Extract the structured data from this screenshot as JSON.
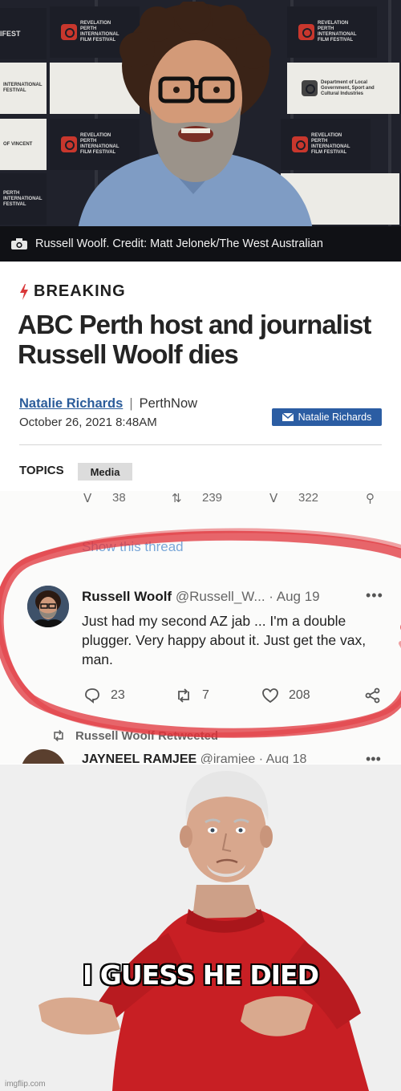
{
  "photo": {
    "caption": "Russell Woolf. Credit: Matt Jelonek/The West Australian",
    "backdrop_tiles": [
      {
        "text": "IFEST"
      },
      {
        "text": "REVELATION PERTH INTERNATIONAL FILM FESTIVAL"
      },
      {
        "text": "REVELATION PERTH INTERNATIONAL FILM FESTIVAL"
      },
      {
        "text": "INTERNATIONAL FESTIVAL"
      },
      {
        "text": "Department of Local Government, Sport and Cultural Industries"
      },
      {
        "text": "OF VINCENT"
      },
      {
        "text": "REVELATION PERTH INTERNATIONAL FILM FESTIVAL"
      },
      {
        "text": "REVELATION PERTH INTERNATIONAL FILM FESTIVAL"
      },
      {
        "text": "PERTH INTERNATIONAL FESTIVAL"
      }
    ]
  },
  "article": {
    "label": "BREAKING",
    "headline": "ABC Perth host and journalist Russell Woolf dies",
    "author": "Natalie Richards",
    "outlet": "PerthNow",
    "date": "October 26, 2021 8:48AM",
    "email_button": "Natalie Richards",
    "topics_label": "TOPICS",
    "topic_tag": "Media"
  },
  "tweet": {
    "prev_counts": {
      "replies": "38",
      "retweets": "239",
      "likes": "322"
    },
    "show_thread": "Show this thread",
    "display_name": "Russell Woolf",
    "handle": "@Russell_W...",
    "time": "· Aug 19",
    "text": "Just had my second AZ jab ... I'm a double plugger. Very happy about it. Just get the vax, man.",
    "replies": "23",
    "retweets": "7",
    "likes": "208",
    "retweeted_label": "Russell Woolf Retweeted",
    "next_name": "JAYNEEL RAMJEE",
    "next_handle": "@iramjee",
    "next_time": "· Aug 18"
  },
  "meme": {
    "caption": "I GUESS HE DIED",
    "watermark": "imgflip.com"
  },
  "colors": {
    "breaking_bolt": "#d9383a",
    "link_blue": "#2b5c9a",
    "button_blue": "#2b5da3",
    "ring_red": "#e0333a",
    "sweater_red": "#c81f24"
  }
}
